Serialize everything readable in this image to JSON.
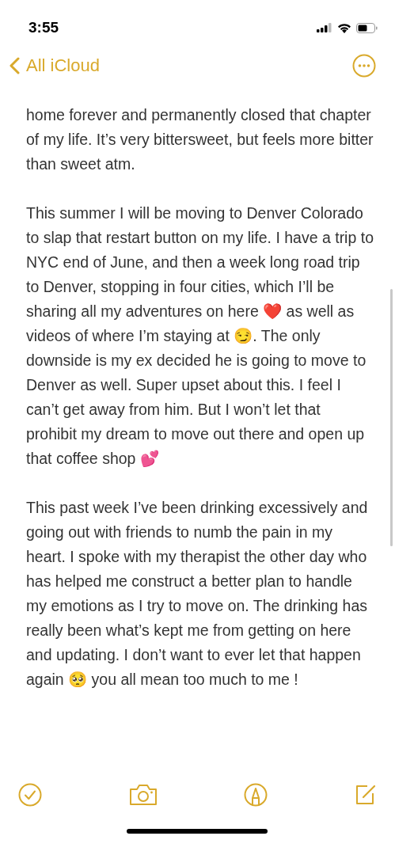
{
  "status_bar": {
    "time": "3:55"
  },
  "nav": {
    "back_label": "All iCloud"
  },
  "note": {
    "paragraphs": [
      "home forever and permanently closed that chapter of my life. It’s very bittersweet, but feels more bitter than sweet atm.",
      "This summer I will be moving to Denver Colorado to slap that restart button on my life. I have a trip to NYC end of June, and then a week long road trip to Denver, stopping in four cities, which I’ll be sharing all my adventures on here ❤️  as well as videos of where I’m staying at 😏. The only downside is my ex decided he is going to move to Denver as well. Super upset about this. I feel I can’t get away from him. But I won’t let that prohibit my dream to move out there and open up that coffee shop 💕",
      "This past week I’ve been drinking excessively and going out with friends to numb the pain in my heart. I spoke with my therapist the other day who has helped me construct a better plan to handle my emotions as I try to move on. The drinking has really been what’s kept me from getting on here and updating. I don’t want to ever let that happen again 🥺  you all mean too much to me !"
    ]
  }
}
